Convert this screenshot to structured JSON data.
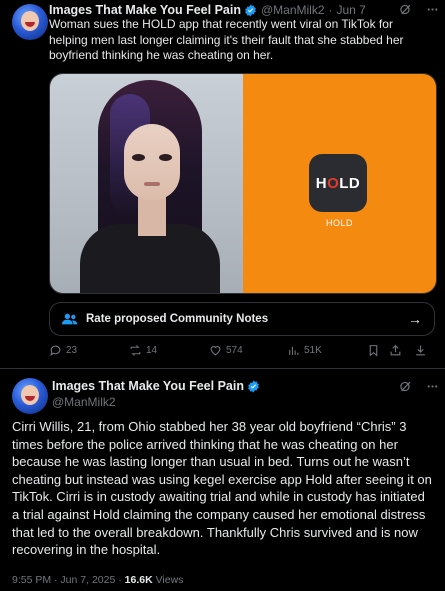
{
  "tweet1": {
    "display_name": "Images That Make You Feel Pain",
    "handle": "@ManMilk2",
    "separator": "·",
    "date": "Jun 7",
    "text": "Woman sues the HOLD app that recently went viral on TikTok for helping men last longer claiming it's their fault that she stabbed her boyfriend thinking he was cheating on her.",
    "media": {
      "logo_left": "H",
      "logo_o": "O",
      "logo_right": "LD",
      "caption": "HOLD",
      "accent": "#f58a10"
    },
    "community_notes_label": "Rate proposed Community Notes",
    "actions": {
      "replies": "23",
      "reposts": "14",
      "likes": "574",
      "views": "51K"
    }
  },
  "tweet2": {
    "display_name": "Images That Make You Feel Pain",
    "handle": "@ManMilk2",
    "text": "Cirri Willis, 21, from Ohio stabbed her 38 year old boyfriend “Chris” 3 times before the police arrived thinking that he was cheating on her because he was lasting longer than usual in bed. Turns out he wasn’t cheating but instead was using kegel exercise app Hold after seeing it on TikTok. Cirri is in custody awaiting trial and while in custody has initiated a trial against Hold claiming the company caused her emotional distress that led to the overall breakdown. Thankfully Chris survived and is now recovering in the hospital.",
    "time": "9:55 PM · Jun 7, 2025 · ",
    "views_count": "16.6K",
    "views_label": "Views"
  },
  "icons": {
    "verified": "verified-badge-icon",
    "grok": "grok-icon",
    "more": "more-icon",
    "reply": "reply-icon",
    "repost": "repost-icon",
    "like": "heart-icon",
    "views": "chart-icon",
    "bookmark": "bookmark-icon",
    "share": "share-icon",
    "download": "download-icon"
  },
  "colors": {
    "verified": "#1d9bf0",
    "muted": "#71767b",
    "text": "#e7e9ea",
    "border": "#2f3336",
    "background": "#000000"
  }
}
